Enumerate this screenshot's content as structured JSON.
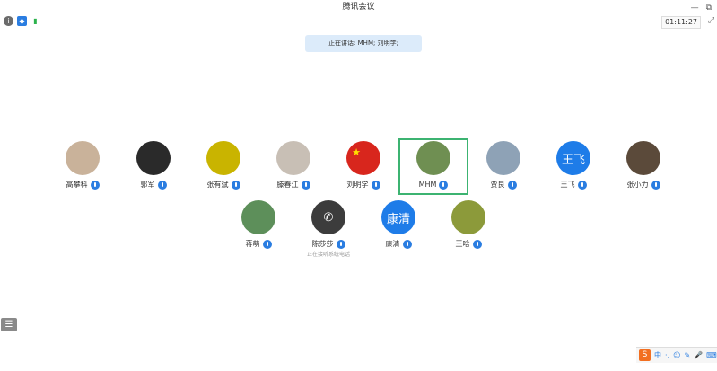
{
  "window": {
    "title": "腾讯会议",
    "min_glyph": "—",
    "restore_glyph": "⧉"
  },
  "topbar": {
    "icons": {
      "info": "i",
      "shield": "◆",
      "signal": "▮"
    },
    "timer": "01:11:27",
    "fullscreen_glyph": "⤢"
  },
  "speaking_banner": "正在讲话: MHM; 刘明学;",
  "participants_row1": [
    {
      "name": "高攀科",
      "avatar_color": "#c9b29a",
      "avatar_text": ""
    },
    {
      "name": "郭军",
      "avatar_color": "#2a2a2a",
      "avatar_text": ""
    },
    {
      "name": "张有斌",
      "avatar_color": "#c9b400",
      "avatar_text": ""
    },
    {
      "name": "滕春江",
      "avatar_color": "#c8bfb5",
      "avatar_text": ""
    },
    {
      "name": "刘明学",
      "avatar_color": "#d8261d",
      "avatar_text": ""
    },
    {
      "name": "MHM",
      "avatar_color": "#6f8f52",
      "avatar_text": ""
    },
    {
      "name": "贾良",
      "avatar_color": "#8ea2b6",
      "avatar_text": ""
    },
    {
      "name": "王飞",
      "avatar_color": "#1e7ce8",
      "avatar_text": "王飞"
    },
    {
      "name": "张小力",
      "avatar_color": "#5b4a3a",
      "avatar_text": ""
    }
  ],
  "participants_row2": [
    {
      "name": "蒋萌",
      "avatar_color": "#5d8f5a",
      "avatar_text": "",
      "sub": ""
    },
    {
      "name": "陈莎莎",
      "avatar_color": "#3c3c3c",
      "avatar_text": "✆",
      "sub": "正在接听系统电话"
    },
    {
      "name": "康清",
      "avatar_color": "#1e7ce8",
      "avatar_text": "康清",
      "sub": ""
    },
    {
      "name": "王晗",
      "avatar_color": "#8c9a3a",
      "avatar_text": "",
      "sub": ""
    }
  ],
  "list_button_glyph": "☰",
  "ime": {
    "logo": "S",
    "mode": "中",
    "items": [
      "·,",
      "☺",
      "✎",
      "🎤",
      "⌨"
    ]
  }
}
